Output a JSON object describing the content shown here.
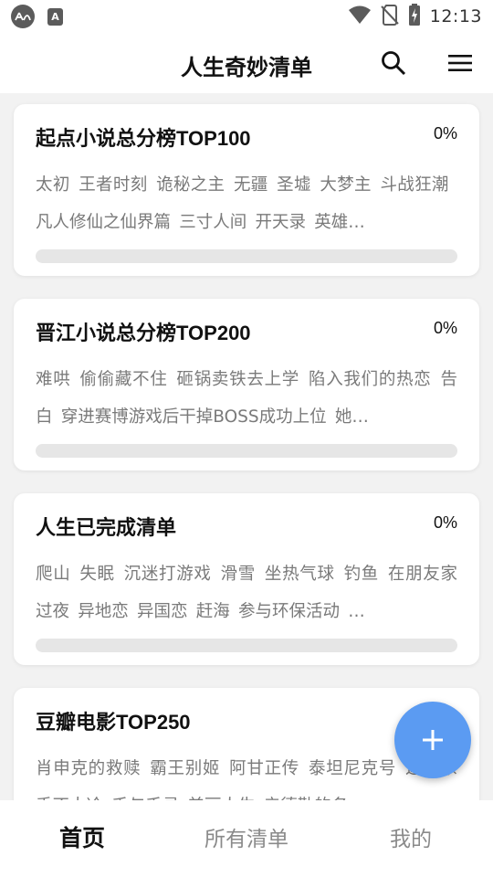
{
  "status_bar": {
    "time": "12:13",
    "a_icon_text": "A"
  },
  "header": {
    "title": "人生奇妙清单"
  },
  "lists": [
    {
      "title": "起点小说总分榜TOP100",
      "percent_text": "0%",
      "progress": 0,
      "items": [
        "太初",
        "王者时刻",
        "诡秘之主",
        "无疆",
        "圣墟",
        "大梦主",
        "斗战狂潮",
        "凡人修仙之仙界篇",
        "三寸人间",
        "开天录",
        "英雄…"
      ]
    },
    {
      "title": "晋江小说总分榜TOP200",
      "percent_text": "0%",
      "progress": 0,
      "items": [
        "难哄",
        "偷偷藏不住",
        "砸锅卖铁去上学",
        "陷入我们的热恋",
        "告白",
        "穿进赛博游戏后干掉BOSS成功上位",
        "她…"
      ]
    },
    {
      "title": "人生已完成清单",
      "percent_text": "0%",
      "progress": 0,
      "items": [
        "爬山",
        "失眠",
        "沉迷打游戏",
        "滑雪",
        "坐热气球",
        "钓鱼",
        "在朋友家过夜",
        "异地恋",
        "异国恋",
        "赶海",
        "参与环保活动",
        "…"
      ]
    },
    {
      "title": "豆瓣电影TOP250",
      "percent_text": "0%",
      "progress": 0,
      "items": [
        "肖申克的救赎",
        "霸王别姬",
        "阿甘正传",
        "泰坦尼克号",
        "这个杀手不太冷",
        "千与千寻",
        "美丽人生",
        "辛德勒的名…"
      ]
    }
  ],
  "bottom_nav": [
    {
      "label": "首页",
      "active": true
    },
    {
      "label": "所有清单",
      "active": false
    },
    {
      "label": "我的",
      "active": false
    }
  ],
  "colors": {
    "accent": "#5b9bf2",
    "progress_track": "#e6e6e6"
  }
}
